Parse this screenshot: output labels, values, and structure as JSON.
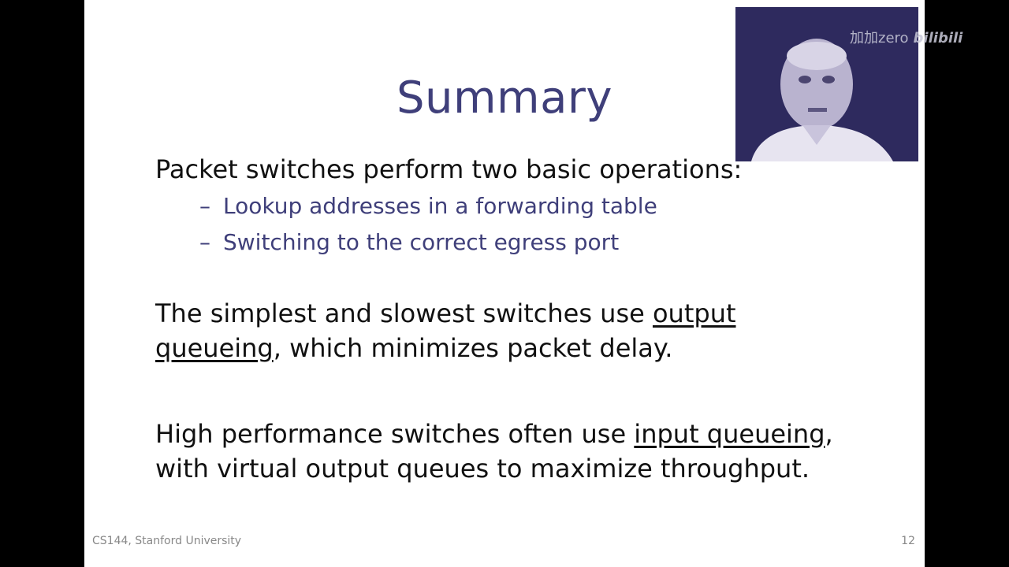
{
  "slide": {
    "title": "Summary",
    "p1": "Packet switches perform two basic operations:",
    "bullets": [
      "Lookup addresses in a forwarding table",
      "Switching to the correct egress port"
    ],
    "bullet_marker": "–",
    "p2_before": "The simplest and slowest switches use ",
    "p2_link": "output queueing",
    "p2_after": ", which minimizes packet delay.",
    "p3_before": "High performance switches often use ",
    "p3_link": "input queueing",
    "p3_after": ", with virtual output queues to maximize throughput.",
    "footer_left": "CS144, Stanford University",
    "page_number": "12"
  },
  "watermark": {
    "uploader": "加加zero",
    "brand": "bilibili"
  },
  "colors": {
    "title": "#3f3f7a",
    "bullet_text": "#3f3f7a",
    "background": "#ffffff",
    "letterbox": "#000000"
  }
}
